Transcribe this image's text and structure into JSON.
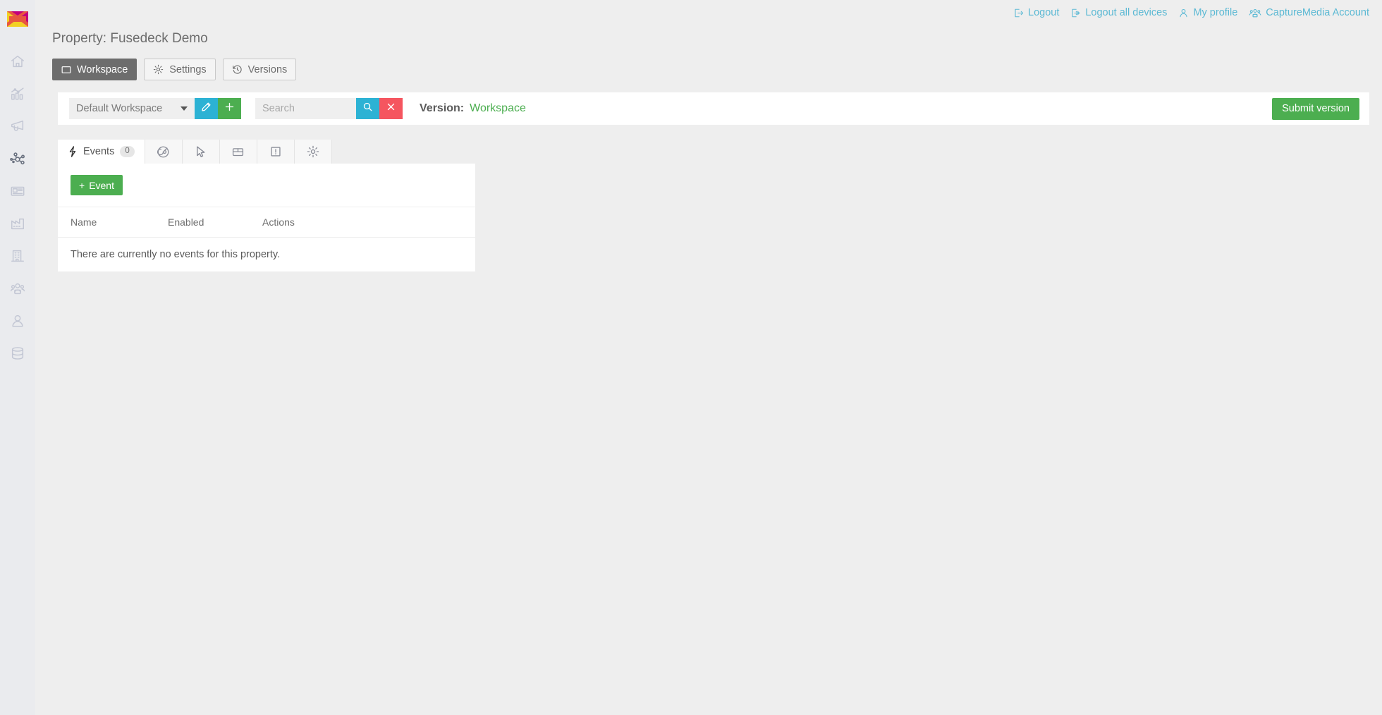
{
  "brand": {
    "logo_name": "fusedeck-logo",
    "colors": {
      "yellow": "#f2d024",
      "magenta": "#c3007a",
      "orange": "#e8573f"
    }
  },
  "topnav": {
    "links": [
      {
        "label": "Logout",
        "icon": "logout-icon"
      },
      {
        "label": "Logout all devices",
        "icon": "logout-all-icon"
      },
      {
        "label": "My profile",
        "icon": "user-icon"
      },
      {
        "label": "CaptureMedia Account",
        "icon": "users-group-icon"
      }
    ],
    "link_color": "#5bb9d4"
  },
  "sidebar": {
    "items": [
      {
        "icon": "home-icon",
        "active": false
      },
      {
        "icon": "analytics-chart-icon",
        "active": false
      },
      {
        "icon": "megaphone-icon",
        "active": false
      },
      {
        "icon": "network-hub-icon",
        "active": true
      },
      {
        "icon": "newspaper-icon",
        "active": false
      },
      {
        "icon": "factory-icon",
        "active": false
      },
      {
        "icon": "building-icon",
        "active": false
      },
      {
        "icon": "users-group-icon",
        "active": false
      },
      {
        "icon": "user-icon",
        "active": false
      },
      {
        "icon": "database-icon",
        "active": false
      }
    ]
  },
  "header": {
    "title": "Property: Fusedeck Demo",
    "buttons": [
      {
        "label": "Workspace",
        "icon": "window-icon",
        "active": true
      },
      {
        "label": "Settings",
        "icon": "gear-icon",
        "active": false
      },
      {
        "label": "Versions",
        "icon": "history-icon",
        "active": false
      }
    ]
  },
  "toolbar": {
    "workspace_select": {
      "value": "Default Workspace"
    },
    "edit_button": {
      "icon": "pencil-icon",
      "color": "#2cb2d4"
    },
    "add_button": {
      "icon": "plus-icon",
      "color": "#4cae50"
    },
    "search": {
      "value": "",
      "placeholder": "Search"
    },
    "search_button": {
      "icon": "search-icon",
      "color": "#2cb2d4"
    },
    "clear_button": {
      "icon": "close-icon",
      "color": "#f5555f"
    },
    "version_label": "Version:",
    "version_value": "Workspace",
    "version_color": "#4cae50",
    "submit_label": "Submit version"
  },
  "tabs": [
    {
      "label": "Events",
      "icon": "lightning-bolt-icon",
      "badge": "0",
      "active": true
    },
    {
      "label": "",
      "icon": "radar-target-icon",
      "badge": "",
      "active": false
    },
    {
      "label": "",
      "icon": "cursor-pointer-icon",
      "badge": "",
      "active": false
    },
    {
      "label": "",
      "icon": "package-box-icon",
      "badge": "",
      "active": false
    },
    {
      "label": "",
      "icon": "alert-box-icon",
      "badge": "",
      "active": false
    },
    {
      "label": "",
      "icon": "gear-icon",
      "badge": "",
      "active": false
    }
  ],
  "content": {
    "add_event_label": "Event",
    "add_event_plus": "+",
    "table": {
      "columns": [
        "Name",
        "Enabled",
        "Actions"
      ],
      "rows": [],
      "empty_message": "There are currently no events for this property."
    }
  }
}
